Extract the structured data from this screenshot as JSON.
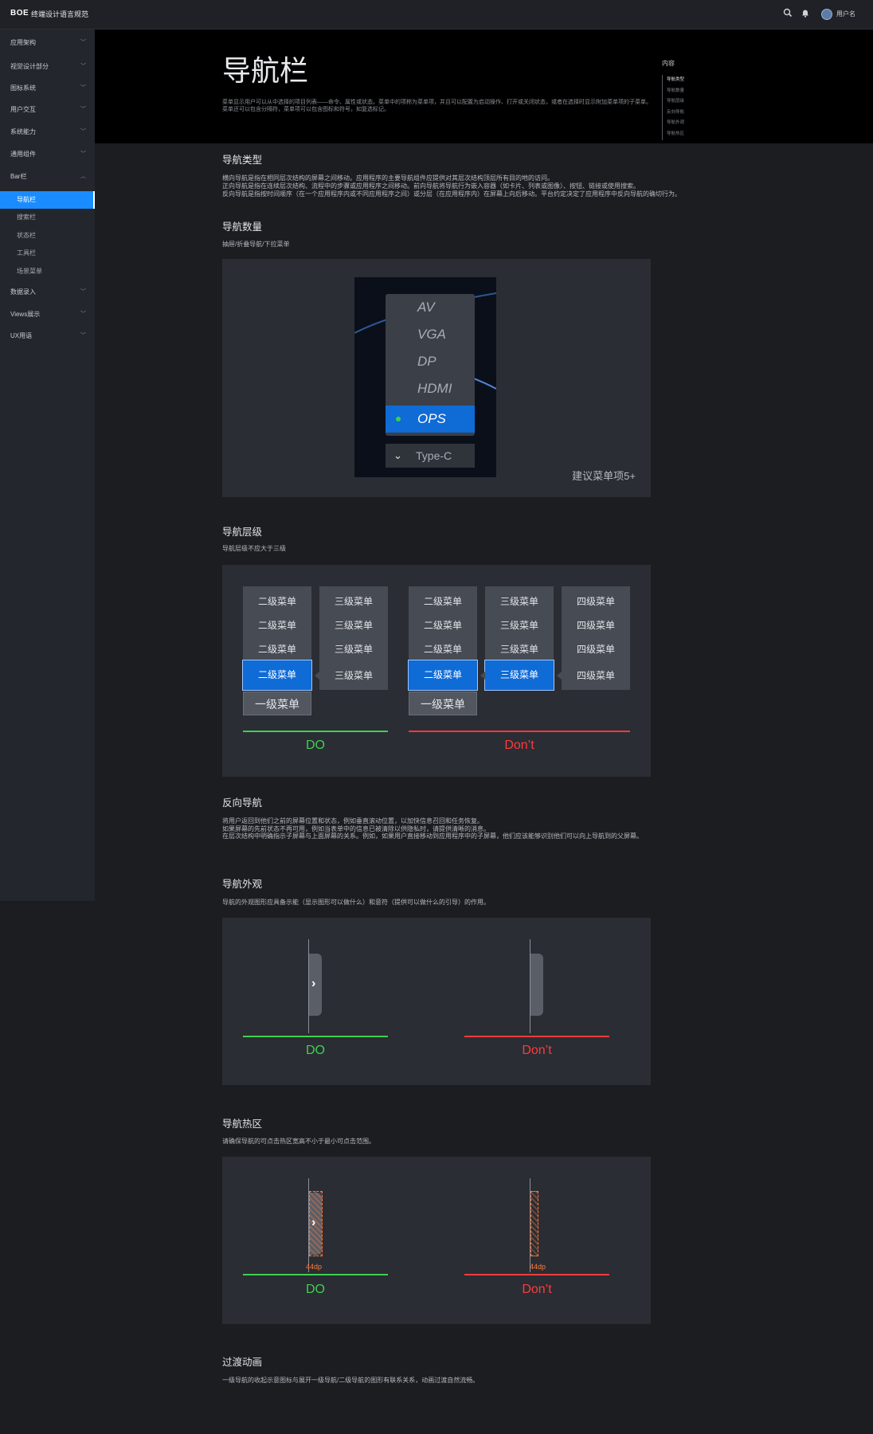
{
  "header": {
    "logo": "BOE",
    "title": "终端设计语言规范",
    "user_name": "用户名"
  },
  "sidebar": {
    "items": [
      {
        "label": "应用架构"
      },
      {
        "label": "视觉设计部分"
      },
      {
        "label": "图标系统"
      },
      {
        "label": "用户交互"
      },
      {
        "label": "系统能力"
      },
      {
        "label": "通用组件"
      },
      {
        "label": "Bar栏"
      },
      {
        "label": "数据录入"
      },
      {
        "label": "Views展示"
      },
      {
        "label": "UX用语"
      }
    ],
    "bar_sub": [
      {
        "label": "导航栏"
      },
      {
        "label": "搜索栏"
      },
      {
        "label": "状态栏"
      },
      {
        "label": "工具栏"
      },
      {
        "label": "场景菜单"
      }
    ]
  },
  "hero": {
    "title": "导航栏",
    "desc": "菜单显示用户可以从中选择的项目列表——命令、属性或状态。菜单中的项称为菜单项，并且可以配置为启动操作、打开或关闭状态，或者在选择时显示附加菜单项的子菜单。菜单还可以包含分隔符，菜单项可以包含图标和符号，如复选标记。"
  },
  "toc": {
    "title": "内容",
    "items": [
      "导航类型",
      "导航数量",
      "导航层级",
      "反向导航",
      "导航外观",
      "导航热区"
    ]
  },
  "sections": {
    "types": {
      "title": "导航类型",
      "lines": [
        "横向导航是指在相同层次结构的屏幕之间移动。应用程序的主要导航组件应提供对其层次结构顶层所有目的地的访问。",
        "正向导航是指在连续层次结构、流程中的步骤或应用程序之间移动。前向导航将导航行为嵌入容器（如卡片、列表或图像）、按钮、链接或使用搜索。",
        "反向导航是指按时间顺序（在一个应用程序内或不同应用程序之间）或分层（在应用程序内）在屏幕上向后移动。平台约定决定了应用程序中反向导航的确切行为。"
      ]
    },
    "count": {
      "title": "导航数量",
      "sub": "抽屉/折叠导航/下拉菜单",
      "menu_items": [
        "AV",
        "VGA",
        "DP",
        "HDMI",
        "OPS"
      ],
      "dropdown": "Type-C",
      "hint": "建议菜单项5+"
    },
    "levels": {
      "title": "导航层级",
      "sub": "导航层级不应大于三级",
      "l2": "二级菜单",
      "l3": "三级菜单",
      "l4": "四级菜单",
      "l1": "一级菜单",
      "do": "DO",
      "dont": "Don’t"
    },
    "back": {
      "title": "反向导航",
      "lines": [
        "将用户返回到他们之前的屏幕位置和状态，例如垂直滚动位置，以加快信息召回和任务恢复。",
        "如果屏幕的先前状态不再可用，例如当表单中的信息已被清除以供隐私时，请提供清晰的消息。",
        "在层次结构中明确指示子屏幕与上面屏幕的关系。例如，如果用户直接移动到应用程序中的子屏幕，他们应该能够识别他们可以向上导航到的父屏幕。"
      ]
    },
    "appearance": {
      "title": "导航外观",
      "sub": "导航的外观图形应具备示能（显示图形可以做什么）和意符（提供可以做什么的引导）的作用。",
      "do": "DO",
      "dont": "Don’t"
    },
    "hotzone": {
      "title": "导航热区",
      "sub": "请确保导航的可点击热区宽高不小于最小可点击范围。",
      "size": "44dp",
      "do": "DO",
      "dont": "Don’t"
    },
    "anim": {
      "title": "过渡动画",
      "sub": "一级导航的收起示意图标与展开一级导航/二级导航的图形有联系关系，动画过渡自然流畅。"
    }
  },
  "colors": {
    "accent": "#1a8cff",
    "selected": "#0f6bd6",
    "do": "#3fd14f",
    "dont": "#ff3b3b",
    "hotzone": "#ff7a3d"
  }
}
